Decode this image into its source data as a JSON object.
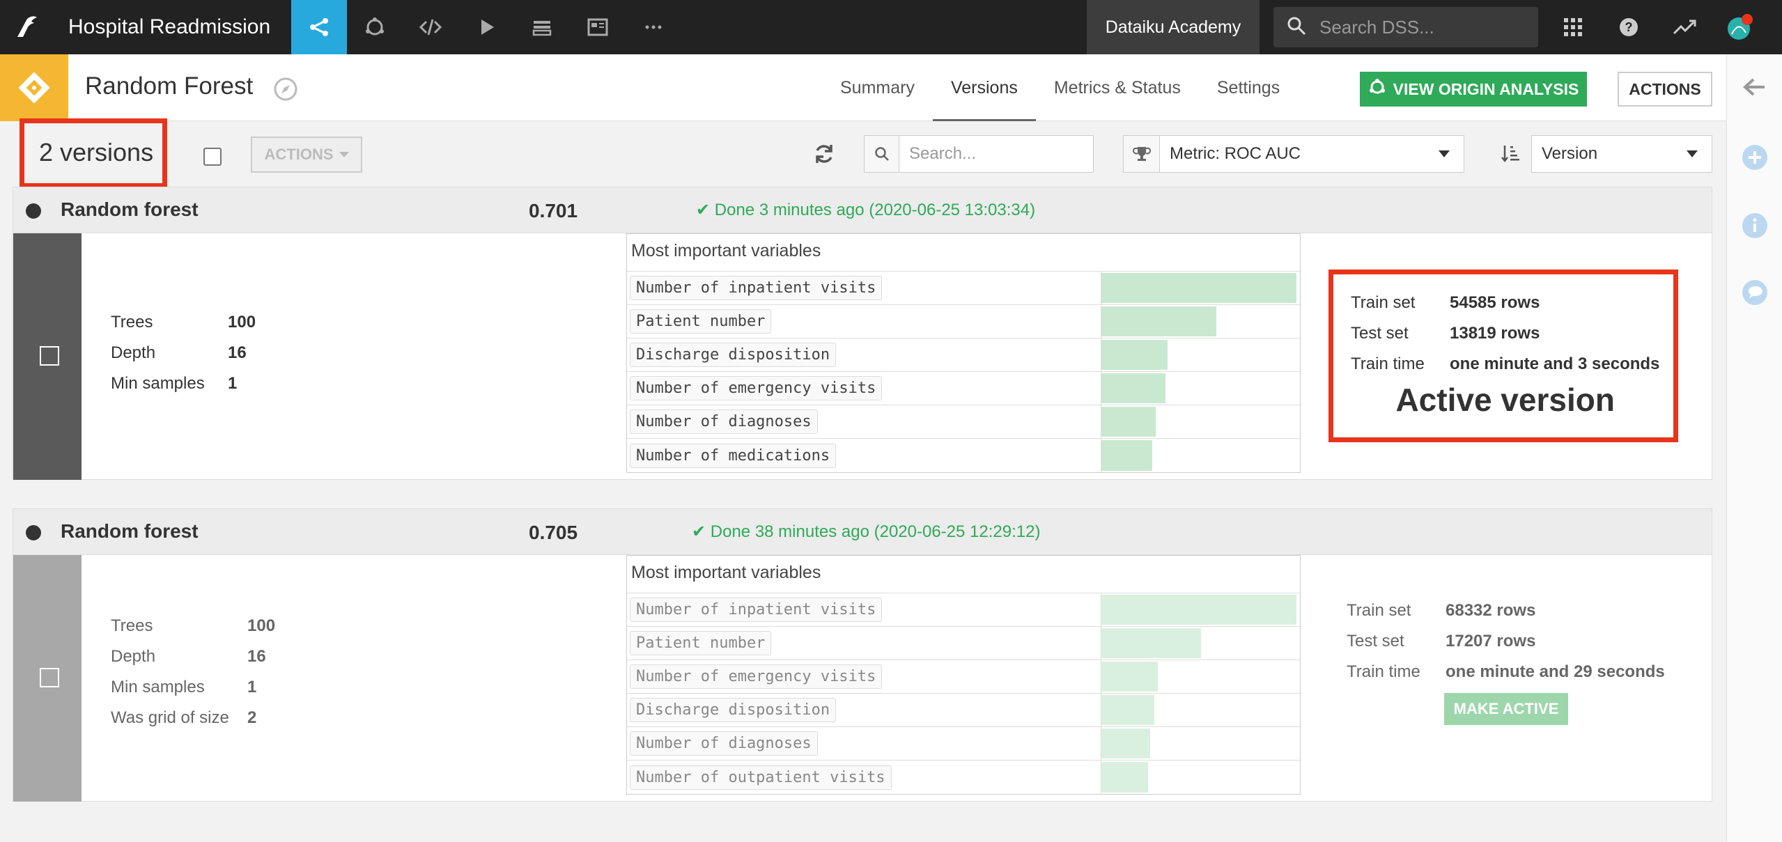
{
  "topnav": {
    "project_title": "Hospital Readmission",
    "academy_label": "Dataiku Academy",
    "search_placeholder": "Search DSS...",
    "nav_icons": [
      "flow-icon",
      "lab-icon",
      "code-icon",
      "run-icon",
      "stack-icon",
      "dashboard-icon",
      "more-icon"
    ],
    "right_icons": [
      "apps-grid-icon",
      "help-icon",
      "trend-icon",
      "user-avatar"
    ]
  },
  "subhead": {
    "model_title": "Random Forest",
    "tabs": [
      {
        "label": "Summary"
      },
      {
        "label": "Versions"
      },
      {
        "label": "Metrics & Status"
      },
      {
        "label": "Settings"
      }
    ],
    "origin_button": "VIEW ORIGIN ANALYSIS",
    "actions_button": "ACTIONS"
  },
  "toolbar": {
    "versions_count": "2 versions",
    "actions_label": "ACTIONS",
    "search_placeholder": "Search...",
    "metric_value": "Metric: ROC AUC",
    "sort_value": "Version"
  },
  "versions": [
    {
      "name": "Random forest",
      "score": "0.701",
      "status": "✔ Done 3 minutes ago (2020-06-25 13:03:34)",
      "params": [
        {
          "k": "Trees",
          "v": "100"
        },
        {
          "k": "Depth",
          "v": "16"
        },
        {
          "k": "Min samples",
          "v": "1"
        }
      ],
      "vars_title": "Most important variables",
      "variables": [
        {
          "name": "Number of inpatient visits",
          "importance": 1.0
        },
        {
          "name": "Patient number",
          "importance": 0.59
        },
        {
          "name": "Discharge disposition",
          "importance": 0.34
        },
        {
          "name": "Number of emergency visits",
          "importance": 0.33
        },
        {
          "name": "Number of diagnoses",
          "importance": 0.28
        },
        {
          "name": "Number of medications",
          "importance": 0.26
        }
      ],
      "info": [
        {
          "k": "Train set",
          "v": "54585 rows"
        },
        {
          "k": "Test set",
          "v": "13819 rows"
        },
        {
          "k": "Train time",
          "v": "one minute and 3 seconds"
        }
      ],
      "active_label": "Active version"
    },
    {
      "name": "Random forest",
      "score": "0.705",
      "status": "✔ Done 38 minutes ago (2020-06-25 12:29:12)",
      "params": [
        {
          "k": "Trees",
          "v": "100"
        },
        {
          "k": "Depth",
          "v": "16"
        },
        {
          "k": "Min samples",
          "v": "1"
        },
        {
          "k": "Was grid of size",
          "v": "2"
        }
      ],
      "vars_title": "Most important variables",
      "variables": [
        {
          "name": "Number of inpatient visits",
          "importance": 1.0
        },
        {
          "name": "Patient number",
          "importance": 0.51
        },
        {
          "name": "Number of emergency visits",
          "importance": 0.29
        },
        {
          "name": "Discharge disposition",
          "importance": 0.27
        },
        {
          "name": "Number of diagnoses",
          "importance": 0.25
        },
        {
          "name": "Number of outpatient visits",
          "importance": 0.24
        }
      ],
      "info": [
        {
          "k": "Train set",
          "v": "68332 rows"
        },
        {
          "k": "Test set",
          "v": "17207 rows"
        },
        {
          "k": "Train time",
          "v": "one minute and 29 seconds"
        }
      ],
      "make_active_label": "MAKE ACTIVE"
    }
  ],
  "colors": {
    "nav_bg": "#222222",
    "active_nav": "#28a9dd",
    "accent_green": "#2eaa58",
    "model_badge": "#f5b731",
    "highlight_red": "#e8341c"
  }
}
